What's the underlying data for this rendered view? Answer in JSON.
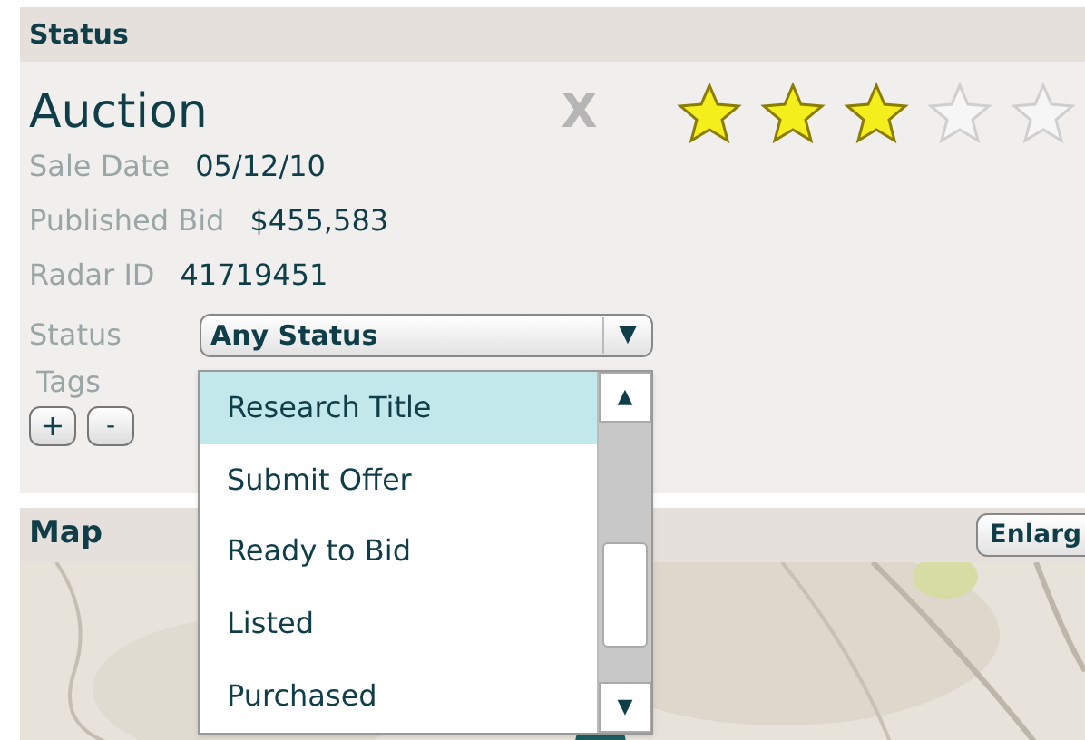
{
  "status_section": {
    "title": "Status",
    "listing_type": "Auction",
    "remove_label": "X",
    "stars": 3,
    "fields": [
      {
        "label": "Sale Date",
        "value": "05/12/10"
      },
      {
        "label": "Published Bid",
        "value": "$455,583"
      },
      {
        "label": "Radar ID",
        "value": "41719451"
      }
    ],
    "status_select": {
      "label": "Status",
      "value": "Any Status",
      "arrow": "▼",
      "options": [
        {
          "label": "Research Title",
          "selected": true
        },
        {
          "label": "Submit Offer",
          "selected": false
        },
        {
          "label": "Ready to Bid",
          "selected": false
        },
        {
          "label": "Listed",
          "selected": false
        },
        {
          "label": "Purchased",
          "selected": false
        }
      ],
      "scroll_up": "▲",
      "scroll_down": "▼"
    },
    "tags": {
      "label": "Tags",
      "add": "+",
      "remove": "-"
    }
  },
  "map_section": {
    "title": "Map",
    "enlarge_button": "Enlarg"
  }
}
